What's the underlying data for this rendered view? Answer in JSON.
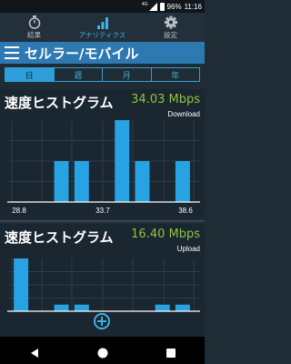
{
  "status": {
    "network": "4G",
    "battery": "96%",
    "time": "11:16"
  },
  "tabs": [
    {
      "label": "結果",
      "icon": "stopwatch-icon"
    },
    {
      "label": "アナリティクス",
      "icon": "bar-chart-icon",
      "active": true
    },
    {
      "label": "設定",
      "icon": "gear-icon"
    }
  ],
  "header": {
    "title": "セルラー/モバイル"
  },
  "periods": [
    {
      "label": "日",
      "active": true
    },
    {
      "label": "週"
    },
    {
      "label": "月"
    },
    {
      "label": "年"
    }
  ],
  "download": {
    "title": "速度ヒストグラム",
    "speed": "34.03 Mbps",
    "type": "Download",
    "ticks": [
      "28.8",
      "33.7",
      "38.6"
    ]
  },
  "upload": {
    "title": "速度ヒストグラム",
    "speed": "16.40 Mbps",
    "type": "Upload"
  },
  "chart_data": [
    {
      "type": "bar",
      "title": "速度ヒストグラム",
      "subtitle": "Download",
      "values": [
        0,
        0,
        1,
        1,
        0,
        2,
        1,
        0,
        1
      ],
      "tick_labels": [
        "28.8",
        "33.7",
        "38.6"
      ],
      "ylim": [
        0,
        2
      ]
    },
    {
      "type": "bar",
      "title": "速度ヒストグラム",
      "subtitle": "Upload",
      "values": [
        4,
        0,
        0.5,
        0.5,
        0,
        0,
        0,
        0.5,
        0.5
      ],
      "ylim": [
        0,
        4
      ]
    }
  ],
  "colors": {
    "bar": "#27a3e3",
    "speed": "#8cc63f",
    "header": "#2e79b2"
  }
}
